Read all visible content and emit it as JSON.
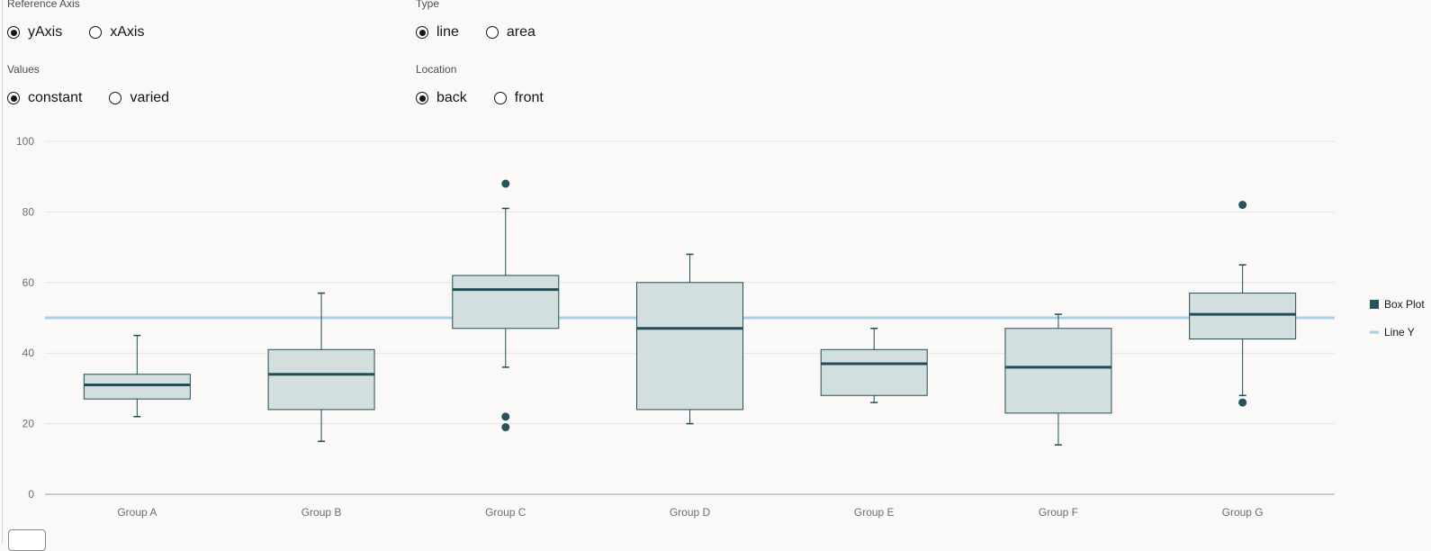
{
  "controls": {
    "reference_axis": {
      "label": "Reference Axis",
      "options": [
        "yAxis",
        "xAxis"
      ],
      "selected": "yAxis"
    },
    "type": {
      "label": "Type",
      "options": [
        "line",
        "area"
      ],
      "selected": "line"
    },
    "values": {
      "label": "Values",
      "options": [
        "constant",
        "varied"
      ],
      "selected": "constant"
    },
    "location": {
      "label": "Location",
      "options": [
        "back",
        "front"
      ],
      "selected": "back"
    }
  },
  "colors": {
    "box_fill": "#d3dfdf",
    "box_stroke": "#1f4e54",
    "median": "#1f4e54",
    "outlier": "#25545b",
    "reference_line": "#a7d0ea",
    "legend_box": "#25545b",
    "grid": "#e4e2df",
    "axis_text": "#6f6d6b"
  },
  "chart_data": {
    "type": "boxplot",
    "categories": [
      "Group A",
      "Group B",
      "Group C",
      "Group D",
      "Group E",
      "Group F",
      "Group G"
    ],
    "ylim": [
      0,
      100
    ],
    "yticks": [
      "0",
      "20",
      "40",
      "60",
      "80",
      "100"
    ],
    "grid": true,
    "series": [
      {
        "name": "Box Plot",
        "boxes": [
          {
            "min": 22,
            "q1": 27,
            "median": 31,
            "q3": 34,
            "max": 45,
            "outliers": []
          },
          {
            "min": 15,
            "q1": 24,
            "median": 34,
            "q3": 41,
            "max": 57,
            "outliers": []
          },
          {
            "min": 36,
            "q1": 47,
            "median": 58,
            "q3": 62,
            "max": 81,
            "outliers": [
              88,
              22,
              19
            ]
          },
          {
            "min": 20,
            "q1": 24,
            "median": 47,
            "q3": 60,
            "max": 68,
            "outliers": []
          },
          {
            "min": 26,
            "q1": 28,
            "median": 37,
            "q3": 41,
            "max": 47,
            "outliers": []
          },
          {
            "min": 14,
            "q1": 23,
            "median": 36,
            "q3": 47,
            "max": 51,
            "outliers": []
          },
          {
            "min": 28,
            "q1": 44,
            "median": 51,
            "q3": 57,
            "max": 65,
            "outliers": [
              82,
              26
            ]
          }
        ]
      },
      {
        "name": "Line Y",
        "reference_line": 50
      }
    ],
    "legend": {
      "position": "right",
      "entries": [
        "Box Plot",
        "Line Y"
      ]
    }
  }
}
